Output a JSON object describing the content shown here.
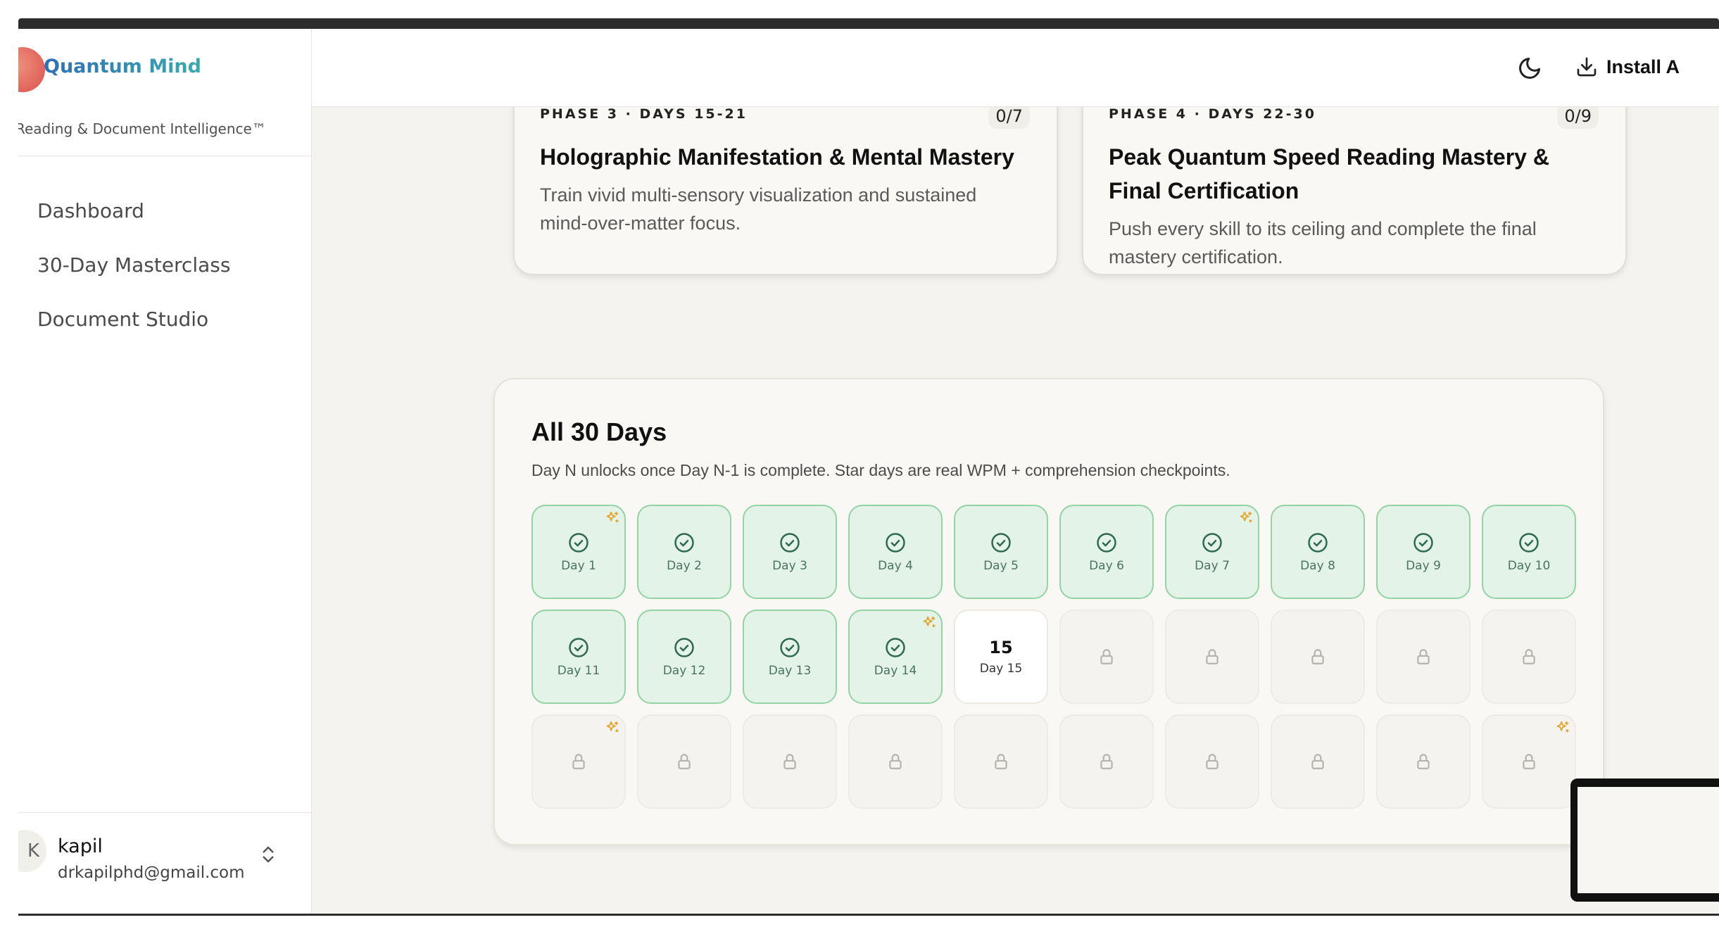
{
  "app": {
    "name": "Quantum Mind",
    "tagline": "Reading & Document Intelligence™"
  },
  "nav": [
    {
      "label": "Dashboard",
      "icon": "grid-icon"
    },
    {
      "label": "30-Day Masterclass",
      "icon": "circle-icon"
    },
    {
      "label": "Document Studio",
      "icon": "doc-icon"
    }
  ],
  "user": {
    "name": "kapil",
    "email": "drkapilphd@gmail.com",
    "avatar_letter": "K"
  },
  "header": {
    "install_label": "Install A"
  },
  "phases": [
    {
      "kicker": "PHASE 3 · DAYS 15-21",
      "count": "0/7",
      "title": "Holographic Manifestation & Mental Mastery",
      "desc": "Train vivid multi-sensory visualization and sustained mind-over-matter focus."
    },
    {
      "kicker": "PHASE 4 · DAYS 22-30",
      "count": "0/9",
      "title": "Peak Quantum Speed Reading Mastery & Final Certification",
      "desc": "Push every skill to its ceiling and complete the final mastery certification."
    }
  ],
  "days_section": {
    "title": "All 30 Days",
    "subtitle": "Day N unlocks once Day N-1 is complete. Star days are real WPM + comprehension checkpoints.",
    "days": [
      {
        "label": "Day 1",
        "status": "done",
        "star": true
      },
      {
        "label": "Day 2",
        "status": "done",
        "star": false
      },
      {
        "label": "Day 3",
        "status": "done",
        "star": false
      },
      {
        "label": "Day 4",
        "status": "done",
        "star": false
      },
      {
        "label": "Day 5",
        "status": "done",
        "star": false
      },
      {
        "label": "Day 6",
        "status": "done",
        "star": false
      },
      {
        "label": "Day 7",
        "status": "done",
        "star": true
      },
      {
        "label": "Day 8",
        "status": "done",
        "star": false
      },
      {
        "label": "Day 9",
        "status": "done",
        "star": false
      },
      {
        "label": "Day 10",
        "status": "done",
        "star": false
      },
      {
        "label": "Day 11",
        "status": "done",
        "star": false
      },
      {
        "label": "Day 12",
        "status": "done",
        "star": false
      },
      {
        "label": "Day 13",
        "status": "done",
        "star": false
      },
      {
        "label": "Day 14",
        "status": "done",
        "star": true
      },
      {
        "label": "Day 15",
        "number": "15",
        "status": "current",
        "star": false
      },
      {
        "status": "locked",
        "star": false
      },
      {
        "status": "locked",
        "star": false
      },
      {
        "status": "locked",
        "star": false
      },
      {
        "status": "locked",
        "star": false
      },
      {
        "status": "locked",
        "star": false
      },
      {
        "status": "locked",
        "star": true
      },
      {
        "status": "locked",
        "star": false
      },
      {
        "status": "locked",
        "star": false
      },
      {
        "status": "locked",
        "star": false
      },
      {
        "status": "locked",
        "star": false
      },
      {
        "status": "locked",
        "star": false
      },
      {
        "status": "locked",
        "star": false
      },
      {
        "status": "locked",
        "star": false
      },
      {
        "status": "locked",
        "star": false
      },
      {
        "status": "locked",
        "star": true
      }
    ]
  },
  "colors": {
    "done_bg": "#e3f3e7",
    "done_border": "#93d3a6",
    "check": "#2f6a4f",
    "star": "#e2a52b",
    "brand_start": "#2e6fb4",
    "brand_end": "#3aaab0"
  }
}
